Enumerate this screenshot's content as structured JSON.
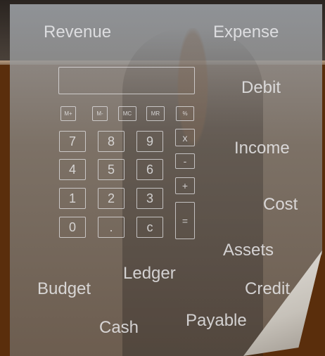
{
  "words": {
    "revenue": "Revenue",
    "expense": "Expense",
    "debit": "Debit",
    "income": "Income",
    "cost": "Cost",
    "assets": "Assets",
    "ledger": "Ledger",
    "budget": "Budget",
    "credit": "Credit",
    "cash": "Cash",
    "payable": "Payable"
  },
  "calculator": {
    "memory_keys": [
      "M+",
      "M-",
      "MC",
      "MR",
      "%"
    ],
    "digit_rows": [
      [
        "7",
        "8",
        "9"
      ],
      [
        "4",
        "5",
        "6"
      ],
      [
        "1",
        "2",
        "3"
      ],
      [
        "0",
        ".",
        "c"
      ]
    ],
    "operators": [
      "x",
      "-",
      "+",
      "="
    ]
  },
  "colors": {
    "background": "#5a2e0c",
    "overlay_text": "#eeeef0"
  }
}
